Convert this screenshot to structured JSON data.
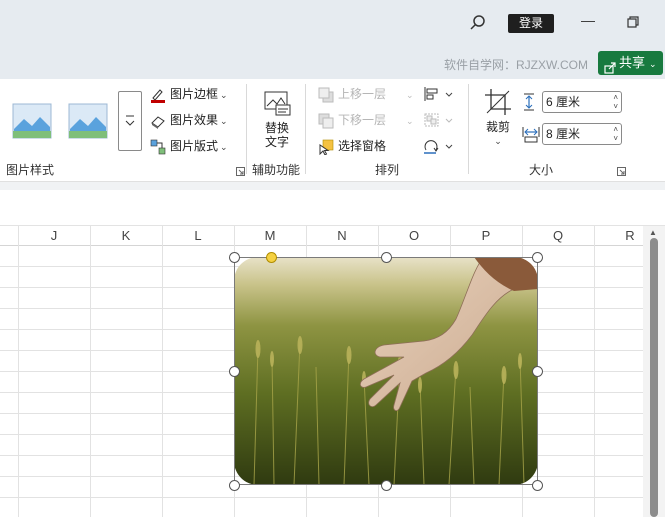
{
  "titlebar": {
    "login_label": "登录",
    "minimize_glyph": "—"
  },
  "info": {
    "watermark": "软件自学网：RJZXW.COM",
    "share_label": "共享"
  },
  "ribbon": {
    "picture_styles": {
      "label": "图片样式",
      "border_label": "图片边框",
      "effect_label": "图片效果",
      "layout_label": "图片版式"
    },
    "accessibility": {
      "label": "辅助功能",
      "alt_text_line1": "替换",
      "alt_text_line2": "文字"
    },
    "arrange": {
      "label": "排列",
      "bring_forward": "上移一层",
      "send_backward": "下移一层",
      "selection_pane": "选择窗格"
    },
    "size": {
      "label": "大小",
      "crop_label": "裁剪",
      "height_value": "6 厘米",
      "width_value": "8 厘米"
    }
  },
  "columns": [
    "J",
    "K",
    "L",
    "M",
    "N",
    "O",
    "P",
    "Q",
    "R"
  ],
  "colors": {
    "accent_share": "#187a3f",
    "border_red": "#c00000",
    "handle_yellow": "#f5d142"
  },
  "icons": [
    "search-icon",
    "restore-icon",
    "share-icon",
    "picture-border-icon",
    "picture-effects-icon",
    "picture-layout-icon",
    "alt-text-icon",
    "bring-forward-icon",
    "send-backward-icon",
    "selection-pane-icon",
    "align-icon",
    "group-icon",
    "rotate-icon",
    "crop-icon",
    "height-icon",
    "width-icon"
  ]
}
